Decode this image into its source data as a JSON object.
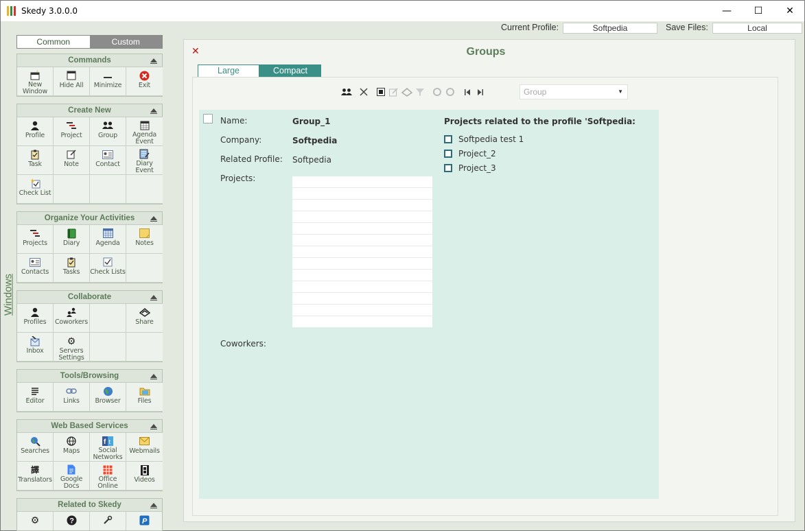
{
  "window": {
    "title": "Skedy 3.0.0.0",
    "minimize": "—",
    "maximize": "☐",
    "close": "✕"
  },
  "side_label": "Windows",
  "sidebar": {
    "tabs": [
      "Common",
      "Custom"
    ],
    "sections": [
      {
        "title": "Commands",
        "items": [
          {
            "label": "New Window",
            "icon": "new-window-icon"
          },
          {
            "label": "Hide All",
            "icon": "hide-all-icon"
          },
          {
            "label": "Minimize",
            "icon": "minimize-icon"
          },
          {
            "label": "Exit",
            "icon": "exit-icon"
          }
        ]
      },
      {
        "title": "Create New",
        "items": [
          {
            "label": "Profile",
            "icon": "profile-icon"
          },
          {
            "label": "Project",
            "icon": "project-icon"
          },
          {
            "label": "Group",
            "icon": "group-icon"
          },
          {
            "label": "Agenda Event",
            "icon": "agenda-event-icon"
          },
          {
            "label": "Task",
            "icon": "task-icon"
          },
          {
            "label": "Note",
            "icon": "note-icon"
          },
          {
            "label": "Contact",
            "icon": "contact-icon"
          },
          {
            "label": "Diary Event",
            "icon": "diary-event-icon"
          },
          {
            "label": "Check List",
            "icon": "check-list-icon"
          }
        ]
      },
      {
        "title": "Organize Your Activities",
        "items": [
          {
            "label": "Projects",
            "icon": "projects-icon"
          },
          {
            "label": "Diary",
            "icon": "diary-icon"
          },
          {
            "label": "Agenda",
            "icon": "agenda-icon"
          },
          {
            "label": "Notes",
            "icon": "notes-icon"
          },
          {
            "label": "Contacts",
            "icon": "contacts-icon"
          },
          {
            "label": "Tasks",
            "icon": "tasks-icon"
          },
          {
            "label": "Check Lists",
            "icon": "check-lists-icon"
          }
        ]
      },
      {
        "title": "Collaborate",
        "items": [
          {
            "label": "Profiles",
            "icon": "profiles-icon"
          },
          {
            "label": "Coworkers",
            "icon": "coworkers-icon"
          },
          {
            "label": "",
            "icon": ""
          },
          {
            "label": "Share",
            "icon": "share-icon"
          },
          {
            "label": "Inbox",
            "icon": "inbox-icon"
          },
          {
            "label": "Servers Settings",
            "icon": "servers-settings-icon"
          }
        ]
      },
      {
        "title": "Tools/Browsing",
        "items": [
          {
            "label": "Editor",
            "icon": "editor-icon"
          },
          {
            "label": "Links",
            "icon": "links-icon"
          },
          {
            "label": "Browser",
            "icon": "browser-icon"
          },
          {
            "label": "Files",
            "icon": "files-icon"
          }
        ]
      },
      {
        "title": "Web Based Services",
        "items": [
          {
            "label": "Searches",
            "icon": "searches-icon"
          },
          {
            "label": "Maps",
            "icon": "maps-icon"
          },
          {
            "label": "Social Networks",
            "icon": "social-networks-icon"
          },
          {
            "label": "Webmails",
            "icon": "webmails-icon"
          },
          {
            "label": "Translators",
            "icon": "translators-icon"
          },
          {
            "label": "Google Docs",
            "icon": "google-docs-icon"
          },
          {
            "label": "Office Online",
            "icon": "office-online-icon"
          },
          {
            "label": "Videos",
            "icon": "videos-icon"
          }
        ]
      },
      {
        "title": "Related to Skedy",
        "items": [
          {
            "label": "",
            "icon": "settings-icon"
          },
          {
            "label": "",
            "icon": "help-icon"
          },
          {
            "label": "",
            "icon": "tools-icon"
          },
          {
            "label": "",
            "icon": "paypal-icon"
          }
        ]
      }
    ]
  },
  "header": {
    "current_profile_label": "Current Profile:",
    "current_profile_value": "Softpedia",
    "save_files_label": "Save Files:",
    "save_files_value": "Local"
  },
  "panel": {
    "close": "✕",
    "title": "Groups",
    "view_tabs": [
      "Large",
      "Compact"
    ],
    "group_select_placeholder": "Group",
    "form": {
      "name_label": "Name:",
      "name_value": "Group_1",
      "company_label": "Company:",
      "company_value": "Softpedia",
      "related_profile_label": "Related Profile:",
      "related_profile_value": "Softpedia",
      "projects_label": "Projects:",
      "coworkers_label": "Coworkers:",
      "related_title": "Projects related to the profile 'Softpedia:",
      "related_projects": [
        "Softpedia test 1",
        "Project_2",
        "Project_3"
      ]
    }
  }
}
